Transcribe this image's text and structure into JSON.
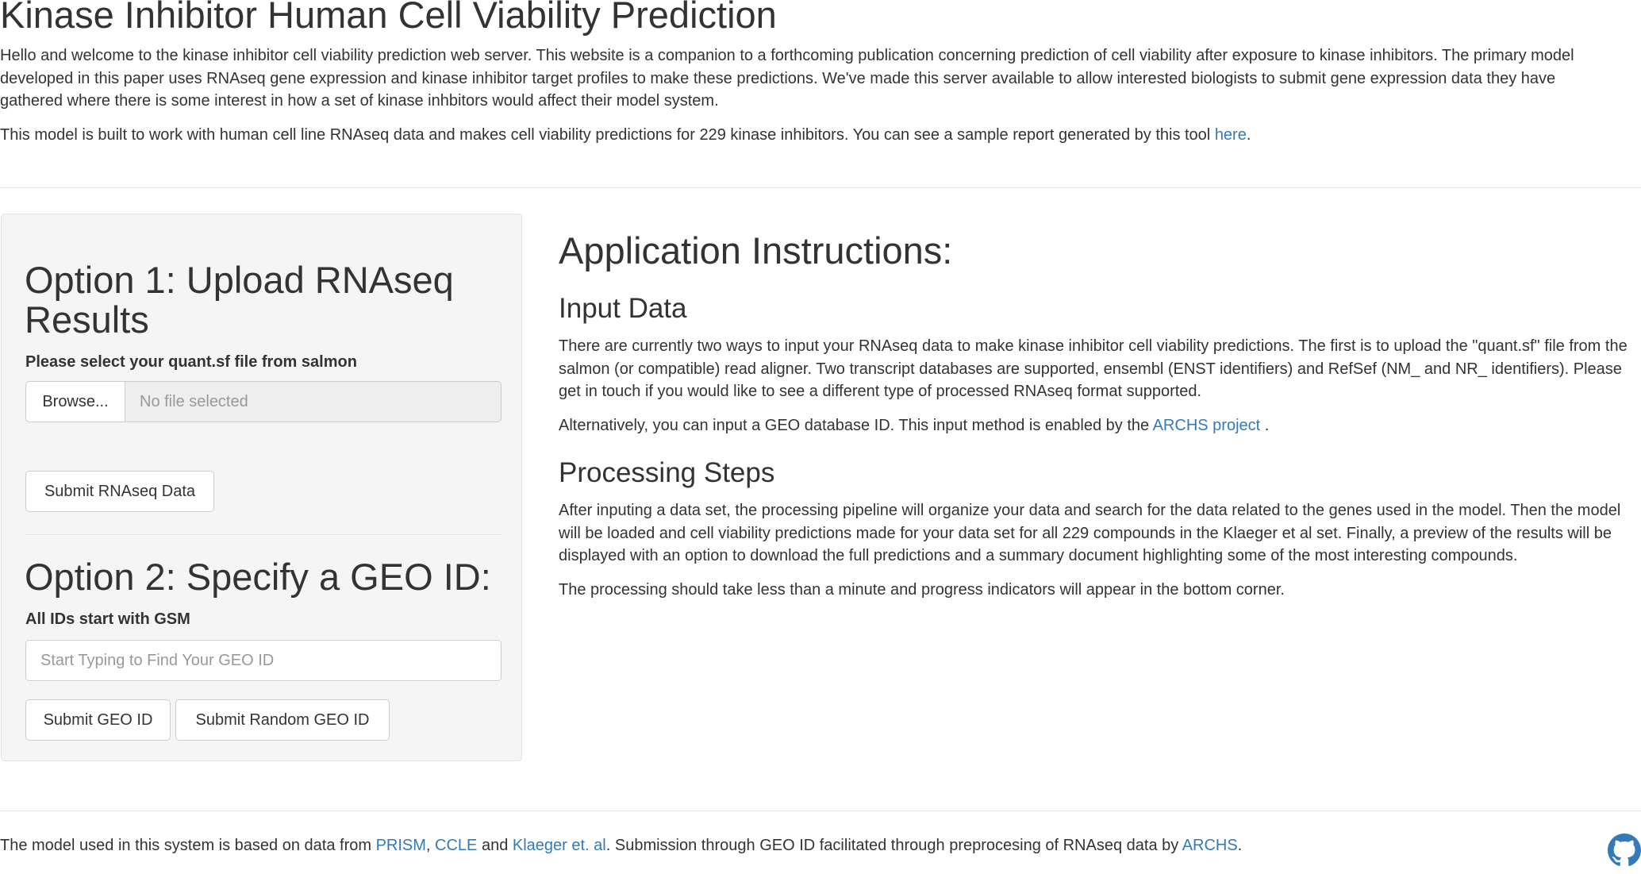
{
  "title": "Kinase Inhibitor Human Cell Viability Prediction",
  "intro": {
    "p1": "Hello and welcome to the kinase inhibitor cell viability prediction web server. This website is a companion to a forthcoming publication concerning prediction of cell viability after exposure to kinase inhibitors. The primary model developed in this paper uses RNAseq gene expression and kinase inhibitor target profiles to make these predictions. We've made this server available to allow interested biologists to submit gene expression data they have gathered where there is some interest in how a set of kinase inhbitors would affect their model system.",
    "p2_before": "This model is built to work with human cell line RNAseq data and makes cell viability predictions for 229 kinase inhibitors. You can see a sample report generated by this tool ",
    "p2_link": "here",
    "p2_after": "."
  },
  "sidebar": {
    "option1": {
      "heading": "Option 1: Upload RNAseq Results",
      "label": "Please select your quant.sf file from salmon",
      "browse_label": "Browse...",
      "file_status": "No file selected",
      "submit_label": "Submit RNAseq Data"
    },
    "option2": {
      "heading": "Option 2: Specify a GEO ID:",
      "label": "All IDs start with GSM",
      "placeholder": "Start Typing to Find Your GEO ID",
      "submit_label": "Submit GEO ID",
      "random_label": "Submit Random GEO ID"
    }
  },
  "instructions": {
    "heading": "Application Instructions:",
    "input_heading": "Input Data",
    "input_p1": "There are currently two ways to input your RNAseq data to make kinase inhibitor cell viability predictions. The first is to upload the \"quant.sf\" file from the salmon (or compatible) read aligner. Two transcript databases are supported, ensembl (ENST identifiers) and RefSef (NM_ and NR_ identifiers). Please get in touch if you would like to see a different type of processed RNAseq format supported.",
    "input_p2_before": "Alternatively, you can input a GEO database ID. This input method is enabled by the ",
    "input_p2_link": "ARCHS project",
    "input_p2_after": " .",
    "processing_heading": "Processing Steps",
    "processing_p1": "After inputing a data set, the processing pipeline will organize your data and search for the data related to the genes used in the model. Then the model will be loaded and cell viability predictions made for your data set for all 229 compounds in the Klaeger et al set. Finally, a preview of the results will be displayed with an option to download the full predictions and a summary document highlighting some of the most interesting compounds.",
    "processing_p2": "The processing should take less than a minute and progress indicators will appear in the bottom corner."
  },
  "footer": {
    "t1": "The model used in this system is based on data from ",
    "link_prism": "PRISM",
    "t2": ", ",
    "link_ccle": "CCLE",
    "t3": " and ",
    "link_klaeger": "Klaeger et. al",
    "t4": ". Submission through GEO ID facilitated through preprocesing of RNAseq data by ",
    "link_archs": "ARCHS",
    "t5": "."
  },
  "icons": {
    "github": "github-icon"
  },
  "colors": {
    "link": "#337ab7",
    "text": "#333333",
    "well": "#f5f5f5"
  }
}
